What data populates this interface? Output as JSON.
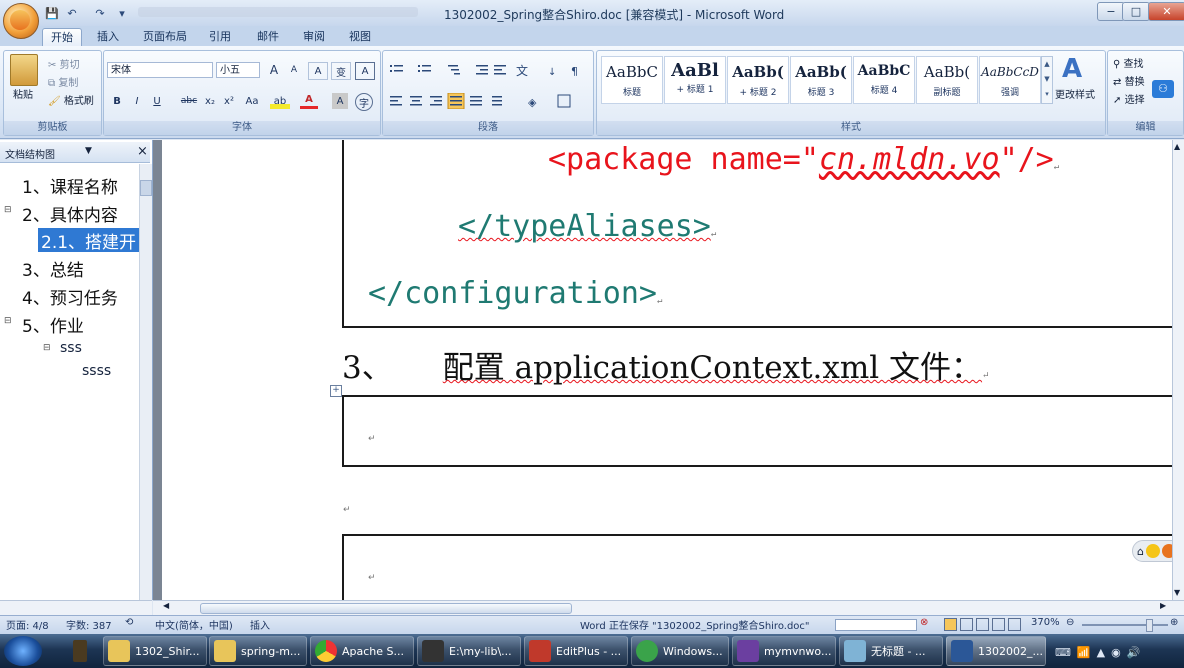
{
  "window": {
    "title": "1302002_Spring整合Shiro.doc [兼容模式] - Microsoft Word",
    "min": "−",
    "max": "□",
    "close": "✕"
  },
  "quick_access": {
    "save": "💾",
    "undo": "↶",
    "redo": "↷",
    "more": "▾"
  },
  "tabs": [
    "开始",
    "插入",
    "页面布局",
    "引用",
    "邮件",
    "审阅",
    "视图"
  ],
  "ribbon": {
    "clipboard": {
      "paste": "粘贴",
      "cut": "剪切",
      "copy": "复制",
      "format_painter": "格式刷",
      "label": "剪贴板"
    },
    "font": {
      "name": "宋体",
      "size": "小五",
      "label": "字体",
      "bold": "B",
      "italic": "I",
      "underline": "U",
      "strike": "abc",
      "sub": "x₂",
      "sup": "x²",
      "change_case": "Aa",
      "grow": "A",
      "shrink": "A",
      "clear": "A",
      "phonetic": "变",
      "border": "A",
      "highlight": "ab",
      "color": "A",
      "shade": "A",
      "enclose": "字"
    },
    "paragraph": {
      "label": "段落"
    },
    "styles": {
      "label": "样式",
      "items": [
        {
          "preview": "AaBbC",
          "name": "标题"
        },
        {
          "preview": "AaBl",
          "name": "+ 标题 1"
        },
        {
          "preview": "AaBb(",
          "name": "+ 标题 2"
        },
        {
          "preview": "AaBb(",
          "name": "标题 3"
        },
        {
          "preview": "AaBbC",
          "name": "标题 4"
        },
        {
          "preview": "AaBb(",
          "name": "副标题"
        },
        {
          "preview": "AaBbCcD",
          "name": "强调"
        }
      ],
      "change_styles": "更改样式"
    },
    "editing": {
      "label": "编辑",
      "find": "查找",
      "replace": "替换",
      "select": "选择"
    }
  },
  "nav_pane": {
    "title": "文档结构图",
    "close": "×",
    "items": [
      {
        "text": "1、课程名称"
      },
      {
        "text": "2、具体内容",
        "toggle": "⊟"
      },
      {
        "text": "2.1、搭建开",
        "selected": true
      },
      {
        "text": "3、总结"
      },
      {
        "text": "4、预习任务"
      },
      {
        "text": "5、作业",
        "toggle": "⊟"
      },
      {
        "text": "sss",
        "toggle": "⊟"
      },
      {
        "text": "ssss"
      }
    ]
  },
  "document": {
    "code_lines": [
      {
        "open": "<package name=\"",
        "value": "cn.mldn.vo",
        "close": "\"/>"
      },
      {
        "text": "</typeAliases>"
      },
      {
        "text": "</configuration>"
      }
    ],
    "heading_num": "3、",
    "heading_text": "配置 applicationContext.xml 文件：",
    "para_mark": "↵"
  },
  "statusbar": {
    "page": "页面: 4/8",
    "words": "字数: 387",
    "lang": "中文(简体，中国)",
    "mode": "插入",
    "saving": "Word 正在保存 \"1302002_Spring整合Shiro.doc\"",
    "zoom": "370%"
  },
  "taskbar": [
    {
      "label": "1302_Shir...",
      "color": "#e8c55a"
    },
    {
      "label": "spring-m...",
      "color": "#e8c55a"
    },
    {
      "label": "Apache S...",
      "color": "#4a90d9"
    },
    {
      "label": "E:\\my-lib\\...",
      "color": "#333333"
    },
    {
      "label": "EditPlus - ...",
      "color": "#c0392b"
    },
    {
      "label": "Windows...",
      "color": "#3aa34a"
    },
    {
      "label": "mymvnwo...",
      "color": "#6b3fa0"
    },
    {
      "label": "无标题 - ...",
      "color": "#7fb3d5"
    },
    {
      "label": "1302002_...",
      "color": "#2b5797"
    }
  ],
  "colors": {
    "code_red": "#e8141c",
    "code_teal": "#1f7a72",
    "accent": "#2b5797"
  }
}
